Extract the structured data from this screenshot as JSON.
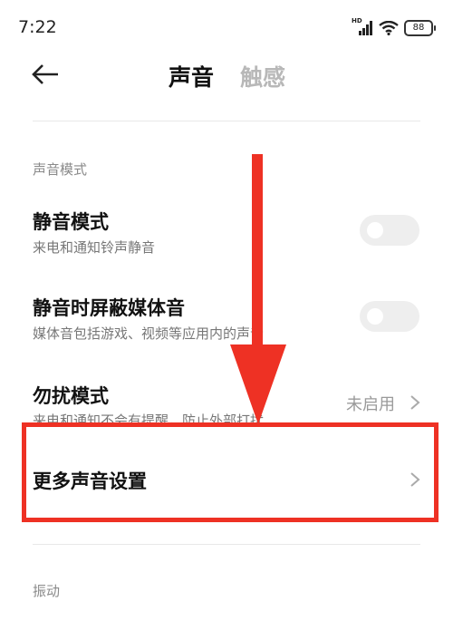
{
  "status_bar": {
    "time": "7:22",
    "network_label": "HD",
    "battery_level": "88"
  },
  "header": {
    "tabs": [
      {
        "label": "声音",
        "active": true
      },
      {
        "label": "触感",
        "active": false
      }
    ]
  },
  "sections": [
    {
      "label": "声音模式"
    },
    {
      "label": "振动"
    }
  ],
  "settings": [
    {
      "title": "静音模式",
      "subtitle": "来电和通知铃声静音",
      "control": "toggle",
      "enabled": false
    },
    {
      "title": "静音时屏蔽媒体音",
      "subtitle": "媒体音包括游戏、视频等应用内的声音",
      "control": "toggle",
      "enabled": false
    },
    {
      "title": "勿扰模式",
      "subtitle": "来电和通知不会有提醒，防止外部打扰",
      "value": "未启用",
      "control": "chevron"
    },
    {
      "title": "更多声音设置",
      "control": "chevron"
    }
  ],
  "annotation": {
    "highlight_color": "#ee3124"
  }
}
